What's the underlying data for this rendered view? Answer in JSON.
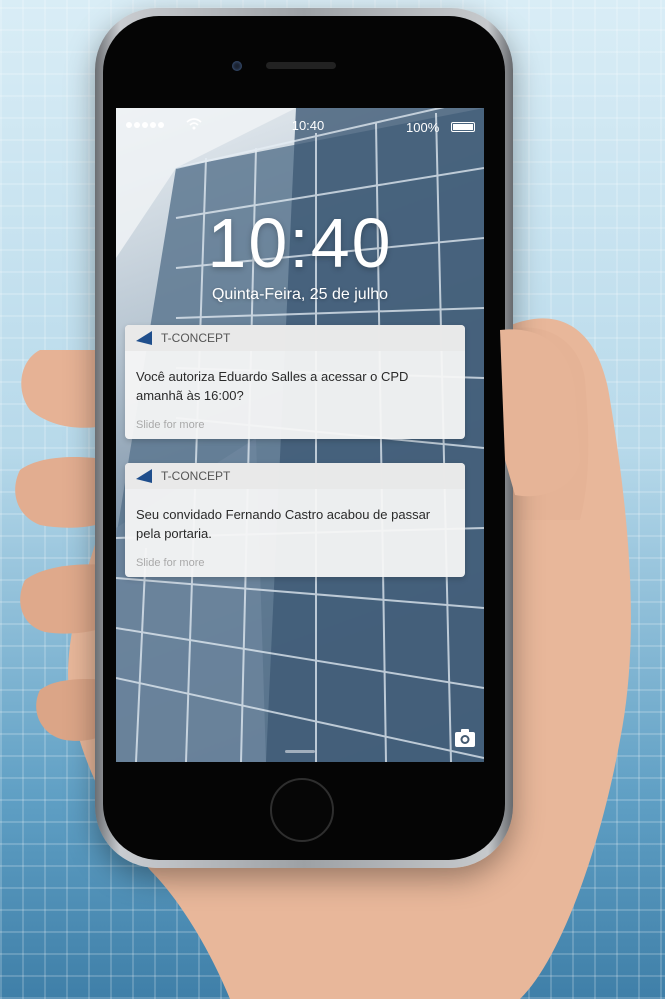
{
  "status_bar": {
    "time": "10:40",
    "battery_percent": "100%"
  },
  "lock_screen": {
    "time": "10:40",
    "date": "Quinta-Feira, 25 de julho"
  },
  "notifications": [
    {
      "app": "T-CONCEPT",
      "message": "Você autoriza Eduardo Salles a acessar o CPD amanhã às 16:00?",
      "more": "Slide for more"
    },
    {
      "app": "T-CONCEPT",
      "message": "Seu convidado Fernando Castro acabou de passar pela portaria.",
      "more": "Slide for more"
    }
  ],
  "colors": {
    "app_icon": "#1f4e8c",
    "notification_bg": "#f6f6f6"
  },
  "icons": {
    "app": "t-concept-logo-icon",
    "camera": "camera-icon",
    "wifi": "wifi-icon"
  }
}
